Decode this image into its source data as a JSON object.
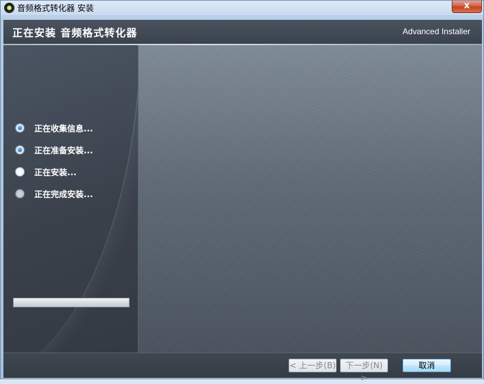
{
  "window": {
    "title": "音频格式转化器 安装",
    "close_label": "x"
  },
  "header": {
    "title": "正在安装 音频格式转化器",
    "brand": "Advanced Installer"
  },
  "steps": [
    {
      "label": "正在收集信息...",
      "state": "done"
    },
    {
      "label": "正在准备安装...",
      "state": "done"
    },
    {
      "label": "正在安装...",
      "state": "current"
    },
    {
      "label": "正在完成安装...",
      "state": "pending"
    }
  ],
  "progress": {
    "value": 0
  },
  "footer": {
    "back_label": "< 上一步(B)",
    "next_label": "下一步(N) >",
    "cancel_label": "取消"
  },
  "colors": {
    "accent": "#1a6fd0",
    "panel_dark": "#3a424b"
  },
  "icons": {
    "app": "audio-converter-icon",
    "close": "close-icon"
  }
}
